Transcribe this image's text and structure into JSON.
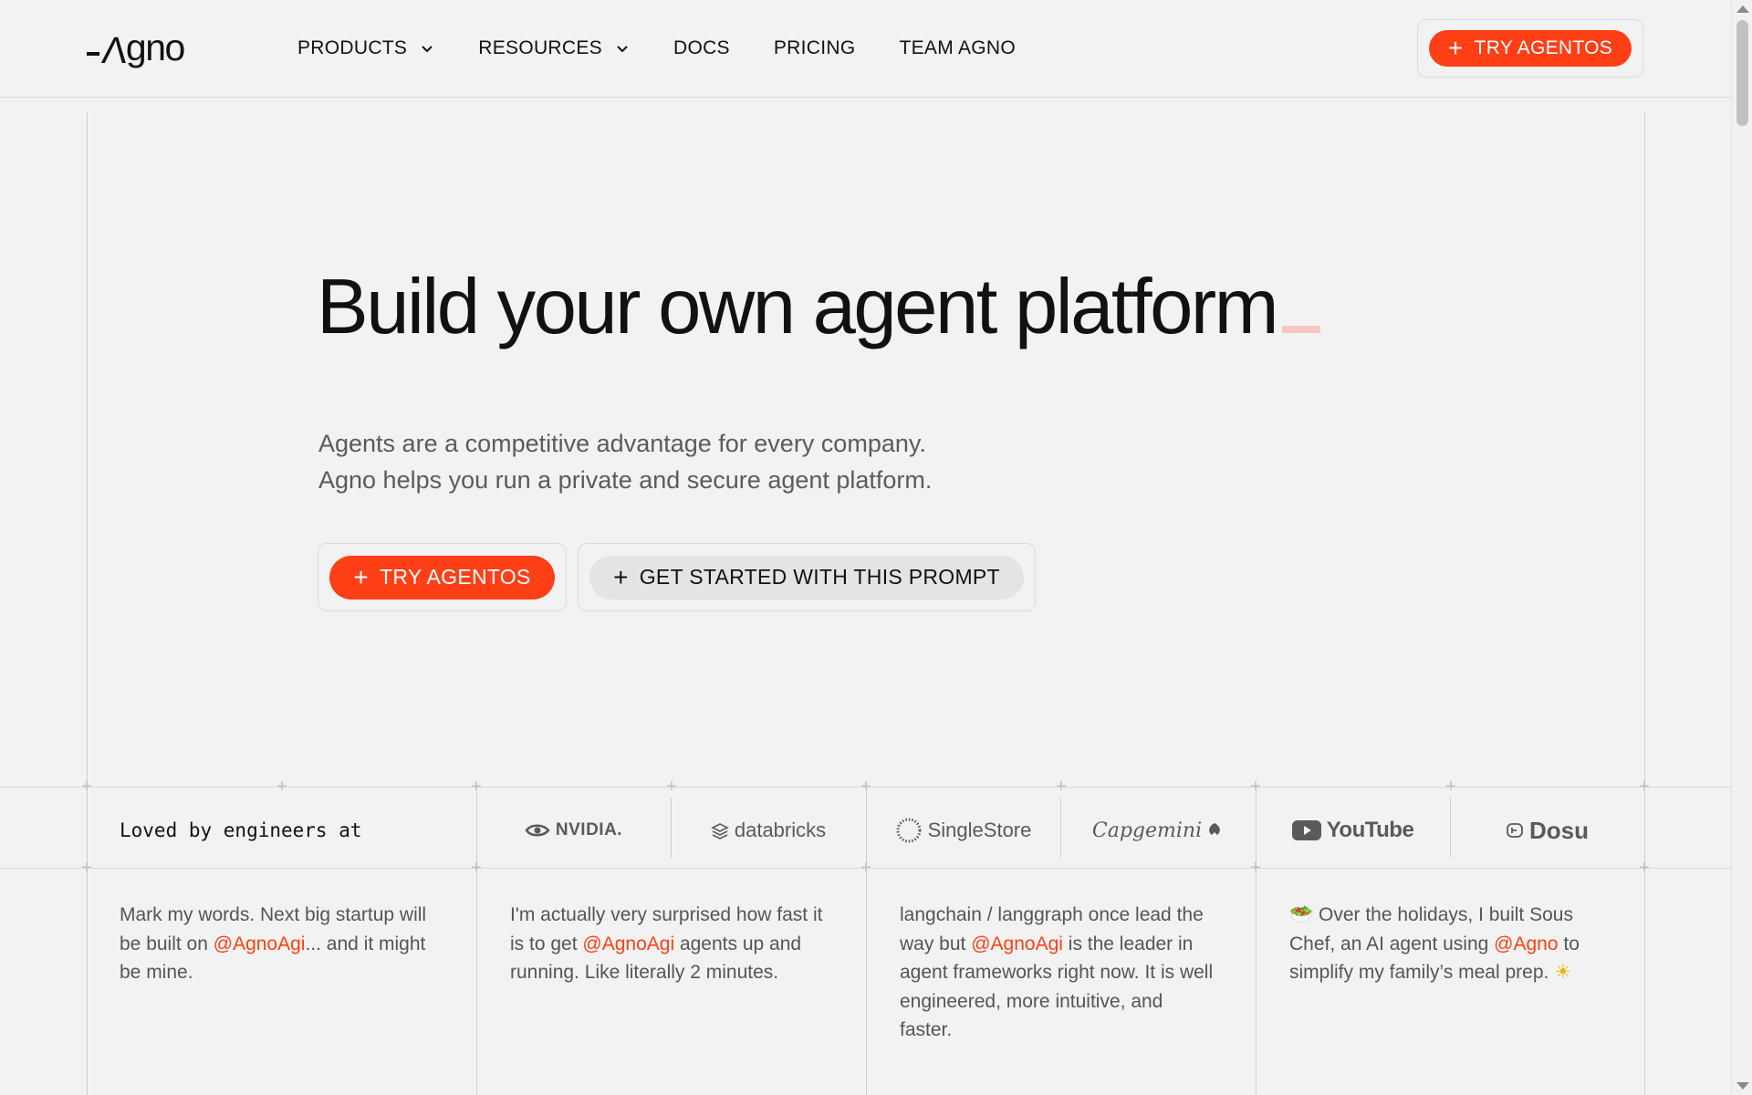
{
  "header": {
    "logo_text": "gno",
    "nav": [
      {
        "label": "PRODUCTS",
        "has_dropdown": true
      },
      {
        "label": "RESOURCES",
        "has_dropdown": true
      },
      {
        "label": "DOCS",
        "has_dropdown": false
      },
      {
        "label": "PRICING",
        "has_dropdown": false
      },
      {
        "label": "TEAM AGNO",
        "has_dropdown": false
      }
    ],
    "cta_label": "TRY AGENTOS"
  },
  "hero": {
    "title": "Build your own agent platform",
    "subtitle_line1": "Agents are a competitive advantage for every company.",
    "subtitle_line2": "Agno helps you run a private and secure agent platform.",
    "primary_cta": "TRY AGENTOS",
    "secondary_cta": "GET STARTED WITH THIS PROMPT"
  },
  "logos": {
    "heading": "Loved by engineers at",
    "brands": [
      "NVIDIA.",
      "databricks",
      "SingleStore",
      "Capgemini",
      "YouTube",
      "Dosu"
    ]
  },
  "testimonials": [
    {
      "before": "Mark my words. Next big startup will be built on ",
      "mention": "@AgnoAgi",
      "after": "... and it might be mine.",
      "emoji_lead": "",
      "emoji_trail": ""
    },
    {
      "before": "I'm actually very surprised how fast it is to get ",
      "mention": "@AgnoAgi",
      "after": " agents up and running. Like literally 2 minutes.",
      "emoji_lead": "",
      "emoji_trail": ""
    },
    {
      "before": "langchain / langgraph once lead the way but ",
      "mention": "@AgnoAgi",
      "after": " is the leader in agent frameworks right now. It is well engineered, more intuitive, and faster.",
      "emoji_lead": "",
      "emoji_trail": ""
    },
    {
      "before": " Over the holidays, I built Sous Chef, an AI agent using ",
      "mention": "@Agno",
      "after": " to simplify my family’s meal prep. ",
      "emoji_lead": "🥗",
      "emoji_trail": "☀"
    }
  ],
  "colors": {
    "accent": "#ff4016",
    "background": "#f2f2f2",
    "grey_button": "#e4e4e4"
  }
}
